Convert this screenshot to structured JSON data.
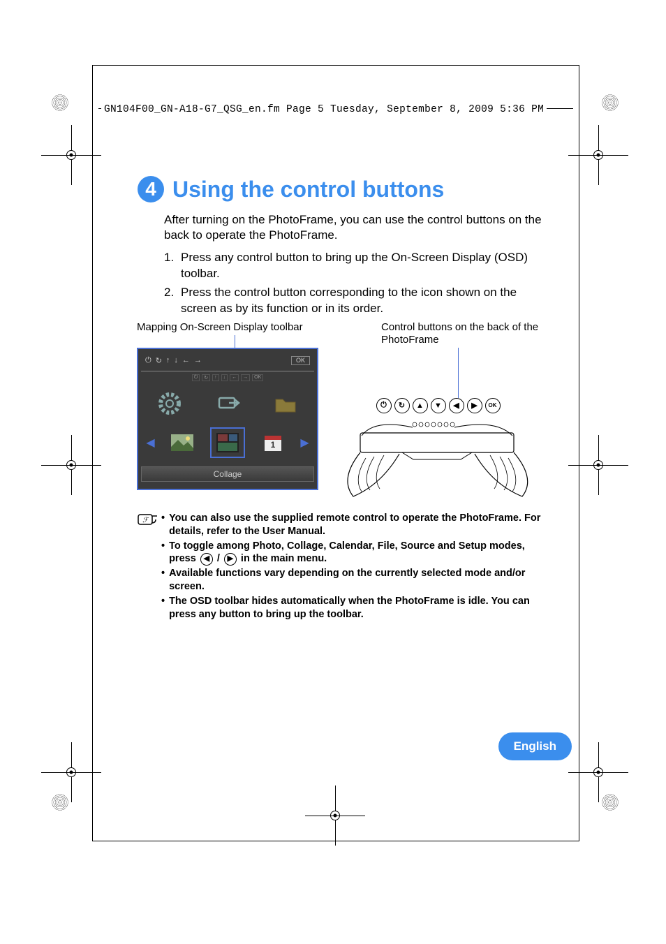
{
  "header": "GN104F00_GN-A18-G7_QSG_en.fm  Page 5  Tuesday, September 8, 2009  5:36 PM",
  "section": {
    "number": "4",
    "title": "Using the control buttons",
    "intro": "After turning on the PhotoFrame, you can use the control buttons on the back to operate the PhotoFrame.",
    "steps": [
      "Press any control button to bring up the On-Screen Display (OSD) toolbar.",
      "Press the control button corresponding to the icon shown on the screen as by its function or in its order."
    ]
  },
  "figure": {
    "left_label": "Mapping On-Screen Display toolbar",
    "right_label": "Control buttons on the back of the PhotoFrame",
    "osd_footer": "Collage",
    "osd_ok": "OK",
    "back_button_ok": "OK"
  },
  "notes": [
    "You can also use the supplied remote control to operate the PhotoFrame. For details, refer to the User Manual.",
    "To toggle among Photo, Collage, Calendar, File, Source and Setup modes, press {LEFT} / {RIGHT} in the main menu.",
    "Available functions vary depending on the currently selected mode and/or screen.",
    "The OSD toolbar hides automatically when the PhotoFrame is idle. You can press any button to bring up the toolbar."
  ],
  "language_badge": "English"
}
